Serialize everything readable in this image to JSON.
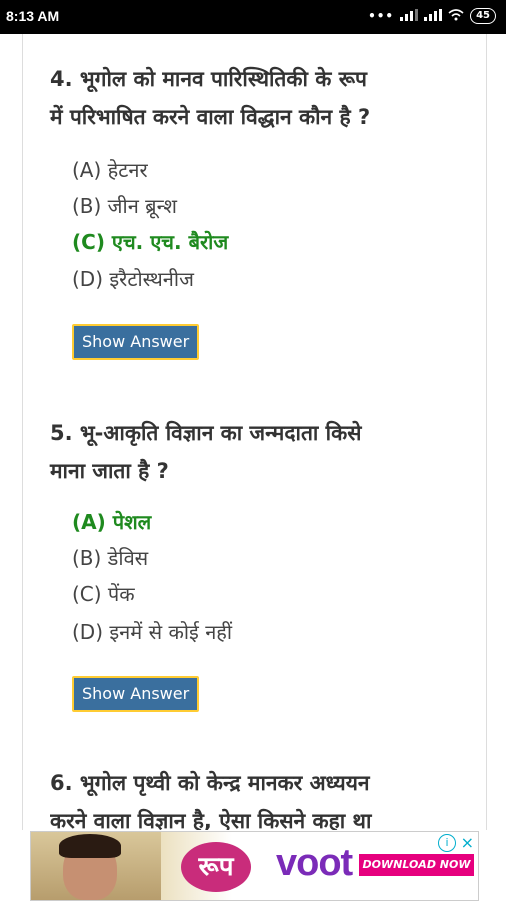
{
  "status": {
    "time": "8:13 AM",
    "battery": "45"
  },
  "questions": [
    {
      "text_line1": "4. भूगोल को मानव पारिस्थितिकी के रूप",
      "text_line2": "में परिभाषित करने वाला विद्धान कौन है ?",
      "options": [
        "(A) हेटनर",
        "(B) जीन ब्रून्श",
        "(C) एच. एच. बैरोज",
        "(D) इरैटोस्थनीज"
      ],
      "correct_index": 2,
      "button": "Show Answer"
    },
    {
      "text_line1": "5. भू-आकृति विज्ञान का जन्मदाता किसे",
      "text_line2": "माना जाता है ?",
      "options": [
        "(A) पेशल",
        "(B) डेविस",
        "(C) पेंक",
        "(D) इनमें से कोई नहीं"
      ],
      "correct_index": 0,
      "button": "Show Answer"
    },
    {
      "text_line1": "6. भूगोल पृथ्वी को केन्द्र मानकर अध्ययन",
      "text_line2": "करने वाला विज्ञान है, ऐसा किसने कहा था"
    }
  ],
  "ad": {
    "brand": "voot",
    "cta": "DOWNLOAD NOW",
    "info": "i",
    "close": "×",
    "logo_text": "रूप"
  }
}
